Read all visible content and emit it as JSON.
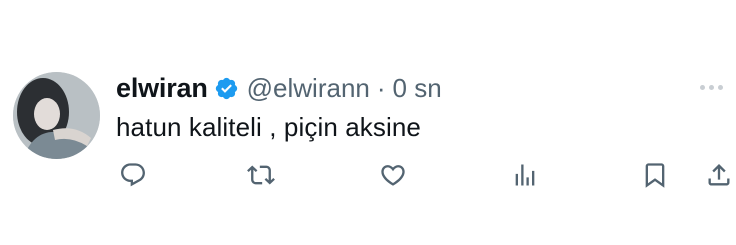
{
  "tweet": {
    "display_name": "elwiran",
    "handle": "@elwirann",
    "separator": "·",
    "time": "0 sn",
    "text": "hatun kaliteli , piçin aksine",
    "verified": true,
    "colors": {
      "verified_badge": "#1d9bf0",
      "icon": "#536471",
      "text": "#0f1419",
      "muted": "#536471"
    }
  },
  "icons": {
    "verified": "verified-badge-icon",
    "more": "more-dots-icon",
    "reply": "reply-icon",
    "retweet": "retweet-icon",
    "like": "heart-icon",
    "views": "views-icon",
    "bookmark": "bookmark-icon",
    "share": "share-icon"
  }
}
